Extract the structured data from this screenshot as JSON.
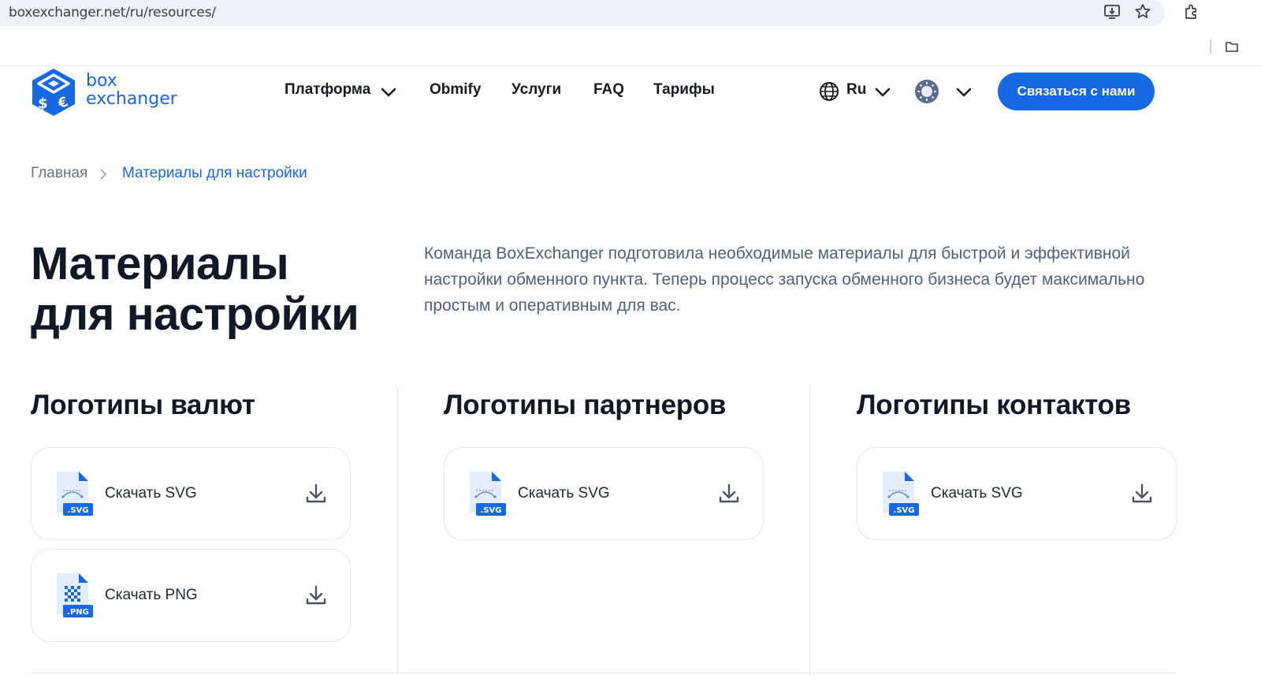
{
  "browser": {
    "url": "boxexchanger.net/ru/resources/"
  },
  "header": {
    "logo_line1": "box",
    "logo_line2": "exchanger",
    "nav": [
      {
        "label": "Платформа",
        "has_dropdown": true
      },
      {
        "label": "Obmify",
        "has_dropdown": false
      },
      {
        "label": "Услуги",
        "has_dropdown": false
      },
      {
        "label": "FAQ",
        "has_dropdown": false
      },
      {
        "label": "Тарифы",
        "has_dropdown": false
      }
    ],
    "language": "Ru",
    "contact_button": "Связаться с нами"
  },
  "breadcrumb": {
    "home": "Главная",
    "current": "Материалы для настройки"
  },
  "hero": {
    "title_line1": "Материалы",
    "title_line2": "для настройки",
    "description": "Команда BoxExchanger подготовила необходимые материалы для быстрой и эффективной настройки обменного пункта. Теперь процесс запуска обменного бизнеса будет максимально простым и оперативным для вас."
  },
  "sections": [
    {
      "title": "Логотипы валют",
      "downloads": [
        {
          "label": "Скачать SVG",
          "badge": ".SVG"
        },
        {
          "label": "Скачать PNG",
          "badge": ".PNG"
        }
      ]
    },
    {
      "title": "Логотипы партнеров",
      "downloads": [
        {
          "label": "Скачать SVG",
          "badge": ".SVG"
        }
      ]
    },
    {
      "title": "Логотипы контактов",
      "downloads": [
        {
          "label": "Скачать SVG",
          "badge": ".SVG"
        }
      ]
    }
  ],
  "colors": {
    "brand_blue": "#1668e3",
    "text_dark": "#111827",
    "text_muted": "#51607d",
    "border": "#e5e7eb"
  }
}
